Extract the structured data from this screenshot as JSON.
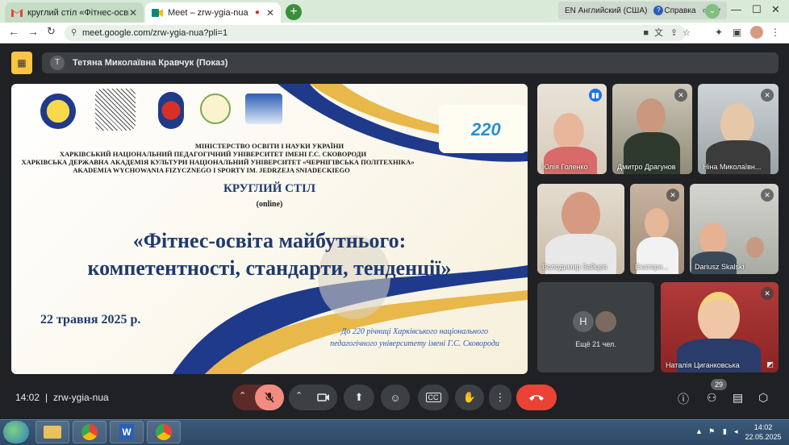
{
  "browser": {
    "tabs": [
      {
        "label": "круглий стіл «Фітнес-освіта майб",
        "favicon": "gmail-icon"
      },
      {
        "label": "Meet – zrw-ygia-nua",
        "favicon": "meet-icon"
      }
    ],
    "new_tab": "+",
    "lang": "EN Английский (США)",
    "help": "Справка",
    "url": "meet.google.com/zrw-ygia-nua?pli=1"
  },
  "meet": {
    "presenter_initial": "Т",
    "presenter_label": "Тетяна Миколаївна Кравчук (Показ)",
    "time": "14:02",
    "code": "zrw-ygia-nua",
    "people_count": "29",
    "more_initial": "Н",
    "more_label": "Ещё 21 чел."
  },
  "slide": {
    "org_lines": [
      "МІНІСТЕРСТВО ОСВІТИ І НАУКИ УКРАЇНИ",
      "ХАРКІВСЬКИЙ НАЦІОНАЛЬНИЙ ПЕДАГОГІЧНИЙ УНІВЕРСИТЕТ ІМЕНІ Г.С. СКОВОРОДИ",
      "ХАРКІВСЬКА ДЕРЖАВНА АКАДЕМІЯ КУЛЬТУРИ НАЦІОНАЛЬНИЙ УНІВЕРСИТЕТ «ЧЕРНІГІВСЬКА ПОЛІТЕХНІКА»",
      "AKADEMIA WYCHOWANIA FIZYCZNEGO I SPORTY IM. JEDRZEJA SNIADECKIEGO"
    ],
    "event_type": "КРУГЛИЙ СТІЛ",
    "format": "(online)",
    "title_line1": "«Фітнес-освіта майбутнього:",
    "title_line2": "компетентності, стандарти, тенденції»",
    "date": "22 травня 2025 р.",
    "anniversary_line1": "До 220 річниці Харківського національного",
    "anniversary_line2": "педагогічного університету імені Г.С. Сковороди",
    "badge_number": "220"
  },
  "participants": [
    {
      "name": "Юлія Голенко"
    },
    {
      "name": "Дмитро Драгунов"
    },
    {
      "name": "Ніна Миколаївн..."
    },
    {
      "name": "Володимир Зайцев"
    },
    {
      "name": "Екатери..."
    },
    {
      "name": "Dariusz Skalski"
    },
    {
      "name": "Наталія Циганковська"
    }
  ],
  "taskbar": {
    "time": "14:02",
    "date": "22.05.2025"
  },
  "colors": {
    "meet_bg": "#202124",
    "end_call": "#ea4335",
    "mic_off": "#f28b82",
    "slide_title": "#1f3a6e"
  }
}
